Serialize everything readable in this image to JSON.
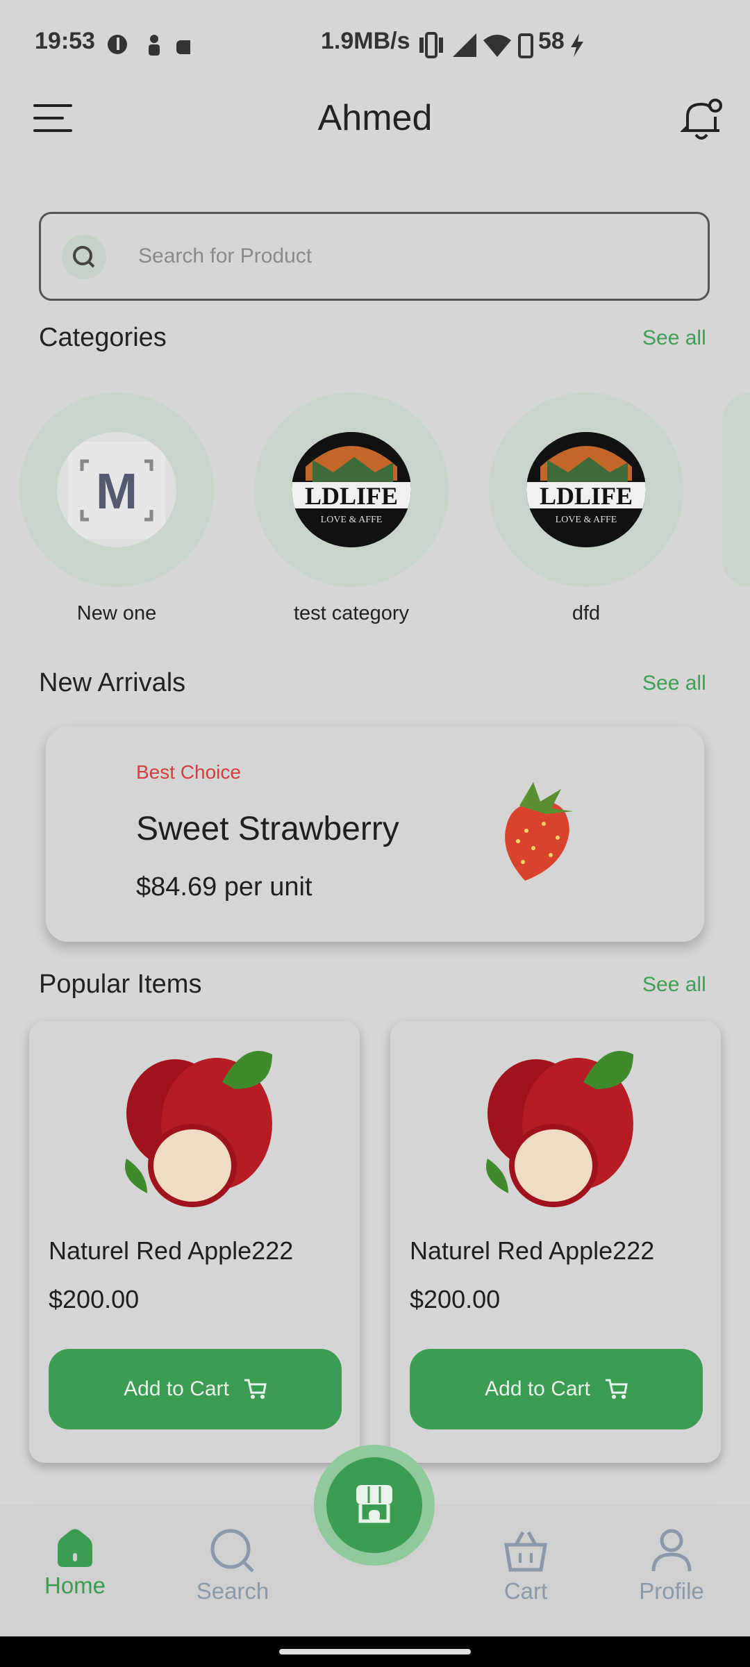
{
  "status_bar": {
    "time": "19:53",
    "network_speed": "1.9MB/s",
    "battery": "58"
  },
  "header": {
    "title": "Ahmed",
    "menu_icon": "hamburger-menu-icon",
    "notification_icon": "bell-icon"
  },
  "search": {
    "placeholder": "Search for Product"
  },
  "categories": {
    "title": "Categories",
    "see_all": "See all",
    "items": [
      {
        "label": "New one"
      },
      {
        "label": "test category"
      },
      {
        "label": "dfd"
      }
    ]
  },
  "new_arrivals": {
    "title": "New Arrivals",
    "see_all": "See all",
    "card": {
      "tag": "Best Choice",
      "name": "Sweet Strawberry",
      "price": "$84.69 per unit"
    }
  },
  "popular_items": {
    "title": "Popular Items",
    "see_all": "See all",
    "items": [
      {
        "name": "Naturel Red Apple222",
        "price": "$200.00",
        "button": "Add to Cart"
      },
      {
        "name": "Naturel Red Apple222",
        "price": "$200.00",
        "button": "Add to Cart"
      }
    ]
  },
  "bottom_nav": {
    "items": [
      {
        "label": "Home",
        "icon": "home-icon",
        "active": true
      },
      {
        "label": "Search",
        "icon": "search-icon",
        "active": false
      },
      {
        "label": "Cart",
        "icon": "basket-icon",
        "active": false
      },
      {
        "label": "Profile",
        "icon": "profile-icon",
        "active": false
      }
    ]
  },
  "colors": {
    "accent": "#3b9c52",
    "tag": "#d14040",
    "background": "#d6d6d6"
  }
}
